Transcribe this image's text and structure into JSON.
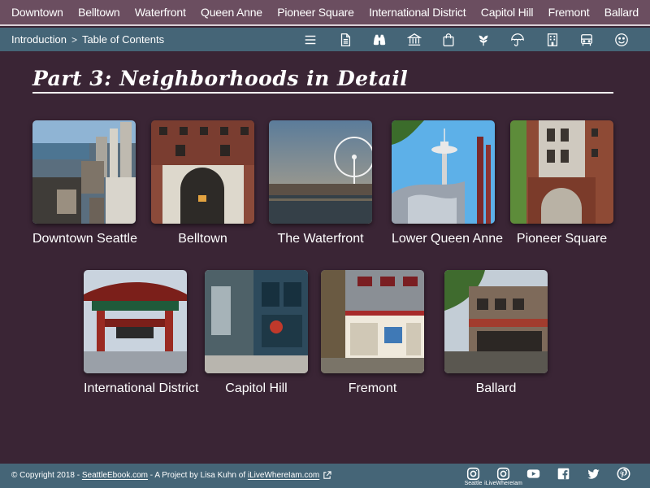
{
  "topnav": {
    "items": [
      "Downtown",
      "Belltown",
      "Waterfront",
      "Queen Anne",
      "Pioneer Square",
      "International District",
      "Capitol Hill",
      "Fremont",
      "Ballard"
    ]
  },
  "breadcrumb": {
    "items": [
      "Introduction",
      "Table of Contents"
    ],
    "separator": ">"
  },
  "toolbar_icons": [
    "menu-icon",
    "document-icon",
    "binoculars-icon",
    "museum-icon",
    "shopping-bag-icon",
    "leaf-icon",
    "umbrella-icon",
    "building-icon",
    "bus-icon",
    "smiley-icon"
  ],
  "page": {
    "title": "Part 3: Neighborhoods in Detail"
  },
  "neighborhoods": [
    {
      "label": "Downtown Seattle"
    },
    {
      "label": "Belltown"
    },
    {
      "label": "The Waterfront"
    },
    {
      "label": "Lower Queen Anne"
    },
    {
      "label": "Pioneer Square"
    },
    {
      "label": "International District"
    },
    {
      "label": "Capitol Hill"
    },
    {
      "label": "Fremont"
    },
    {
      "label": "Ballard"
    }
  ],
  "footer": {
    "copyright": "© Copyright 2018 - ",
    "site_link": "SeattleEbook.com",
    "middle": " - A Project by Lisa Kuhn of ",
    "author_link": "iLiveWhereIam.com"
  },
  "social": [
    {
      "icon": "instagram-icon",
      "caption": "Seattle"
    },
    {
      "icon": "instagram-icon",
      "caption": "iLiveWhereIam"
    },
    {
      "icon": "youtube-icon",
      "caption": ""
    },
    {
      "icon": "facebook-icon",
      "caption": ""
    },
    {
      "icon": "twitter-icon",
      "caption": ""
    },
    {
      "icon": "pinterest-icon",
      "caption": ""
    }
  ],
  "colors": {
    "background": "#3a2535",
    "topnav": "#6b4e60",
    "subbar": "#456577",
    "footer": "#456577"
  }
}
